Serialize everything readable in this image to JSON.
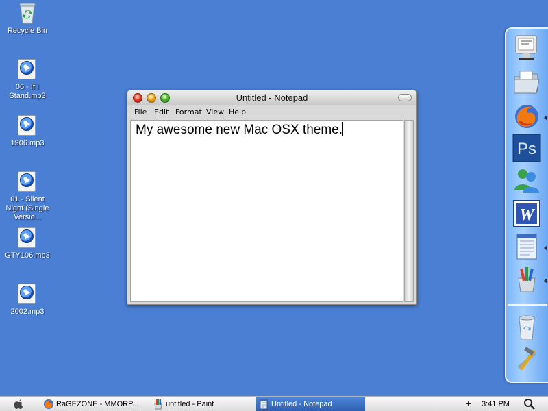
{
  "desktop": {
    "icons": [
      {
        "label": "Recycle Bin",
        "icon": "recycle-bin-icon"
      },
      {
        "label": "06 - If I Stand.mp3",
        "icon": "mp3-file-icon"
      },
      {
        "label": "1906.mp3",
        "icon": "mp3-file-icon"
      },
      {
        "label": "01 - Silent Night (Single Versio...",
        "icon": "mp3-file-icon"
      },
      {
        "label": "GTY106.mp3",
        "icon": "mp3-file-icon"
      },
      {
        "label": "2002.mp3",
        "icon": "mp3-file-icon"
      }
    ]
  },
  "notepad": {
    "title": "Untitled - Notepad",
    "menu": [
      "File",
      "Edit",
      "Format",
      "View",
      "Help"
    ],
    "content": "My awesome new Mac OSX theme."
  },
  "dock": {
    "items": [
      "monitor-icon",
      "folder-icon",
      "firefox-icon",
      "photoshop-icon",
      "messenger-icon",
      "word-icon",
      "notepad-icon",
      "paint-icon",
      "trash-icon",
      "tools-icon"
    ],
    "photoshop_label": "Ps",
    "word_label": "W"
  },
  "taskbar": {
    "start_icon": "apple-icon",
    "tasks": [
      {
        "label": "RaGEZONE - MMORP...",
        "icon": "firefox-icon",
        "active": false
      },
      {
        "label": "untitled - Paint",
        "icon": "paint-icon",
        "active": false
      },
      {
        "label": "Untitled - Notepad",
        "icon": "notepad-icon",
        "active": true
      }
    ],
    "tray_plus": "+",
    "clock": "3:41 PM",
    "search_icon": "magnifier-icon"
  },
  "colors": {
    "desktop": "#4a7fd4",
    "taskbar_active": "#3a6fc4",
    "dock": "#8cc2ff"
  }
}
